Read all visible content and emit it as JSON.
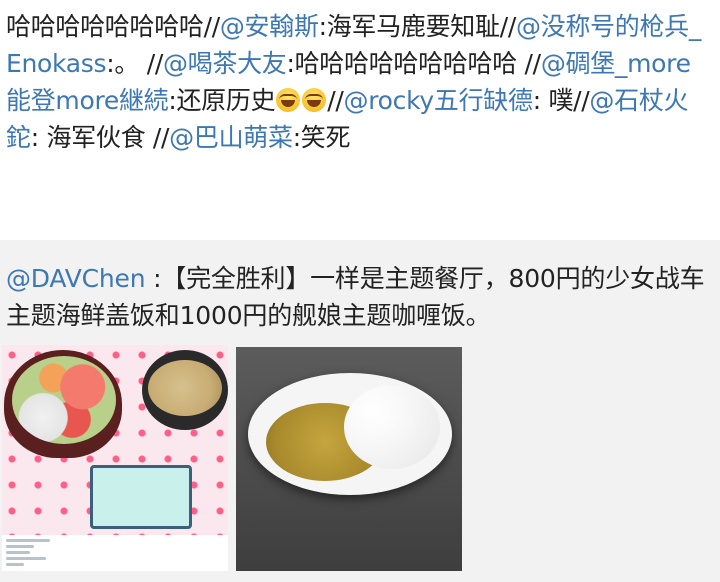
{
  "post": {
    "segments": [
      {
        "text": "哈哈哈哈哈哈哈哈//",
        "kind": "text"
      },
      {
        "text": "@安翰斯",
        "kind": "mention"
      },
      {
        "text": ":海军马鹿要知耻//",
        "kind": "text"
      },
      {
        "text": "@没称号的枪兵_Enokass",
        "kind": "mention"
      },
      {
        "text": ":。 //",
        "kind": "text"
      },
      {
        "text": "@喝茶大友",
        "kind": "mention"
      },
      {
        "text": ":哈哈哈哈哈哈哈哈哈 //",
        "kind": "text"
      },
      {
        "text": "@碉堡_more能登more継続",
        "kind": "mention"
      },
      {
        "text": ":还原历史",
        "kind": "text"
      },
      {
        "text": "laughing-emoji",
        "kind": "emoji"
      },
      {
        "text": "laughing-emoji",
        "kind": "emoji"
      },
      {
        "text": "//",
        "kind": "text"
      },
      {
        "text": "@rocky五行缺德",
        "kind": "mention"
      },
      {
        "text": ": 噗//",
        "kind": "text"
      },
      {
        "text": "@石杖火鉈",
        "kind": "mention"
      },
      {
        "text": ": 海军伙食 //",
        "kind": "text"
      },
      {
        "text": "@巴山萌菜",
        "kind": "mention"
      },
      {
        "text": ":笑死",
        "kind": "text"
      }
    ]
  },
  "repost": {
    "author": "@DAVChen",
    "text": " :【完全胜利】一样是主题餐厅，800円的少女战车主题海鲜盖饭和1000円的舰娘主题咖喱饭。"
  },
  "images": [
    {
      "name": "seafood-don-photo"
    },
    {
      "name": "curry-rice-photo"
    }
  ],
  "colors": {
    "mention": "#3d78b4",
    "repost_bg": "#f2f2f2"
  }
}
